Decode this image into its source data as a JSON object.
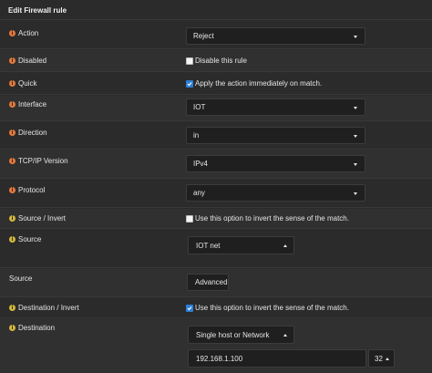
{
  "header": {
    "title": "Edit Firewall rule"
  },
  "rows": {
    "action": {
      "label": "Action",
      "value": "Reject"
    },
    "disabled": {
      "label": "Disabled",
      "checkbox_text": "Disable this rule",
      "checked": false
    },
    "quick": {
      "label": "Quick",
      "checkbox_text": "Apply the action immediately on match.",
      "checked": true
    },
    "interface": {
      "label": "Interface",
      "value": "IOT"
    },
    "direction": {
      "label": "Direction",
      "value": "in"
    },
    "tcpip": {
      "label": "TCP/IP Version",
      "value": "IPv4"
    },
    "protocol": {
      "label": "Protocol",
      "value": "any"
    },
    "source_invert": {
      "label": "Source / Invert",
      "checkbox_text": "Use this option to invert the sense of the match.",
      "checked": false
    },
    "source": {
      "label": "Source",
      "value": "IOT net"
    },
    "source_advanced": {
      "label": "Source",
      "button": "Advanced"
    },
    "dest_invert": {
      "label": "Destination / Invert",
      "checkbox_text": "Use this option to invert the sense of the match.",
      "checked": true
    },
    "destination": {
      "label": "Destination",
      "value": "Single host or Network",
      "address": "192.168.1.100",
      "mask": "32"
    }
  },
  "colors": {
    "background": "#2b2b2b",
    "input_bg": "#1f1f1f",
    "info_orange": "#e8793a",
    "info_yellow": "#d6b93a",
    "checkbox_checked": "#2d7fd6"
  },
  "icons": {
    "info": "info-circle-icon",
    "dropdown": "chevron-down-icon",
    "dropdown_up": "chevron-up-icon",
    "check": "checkmark-icon"
  }
}
